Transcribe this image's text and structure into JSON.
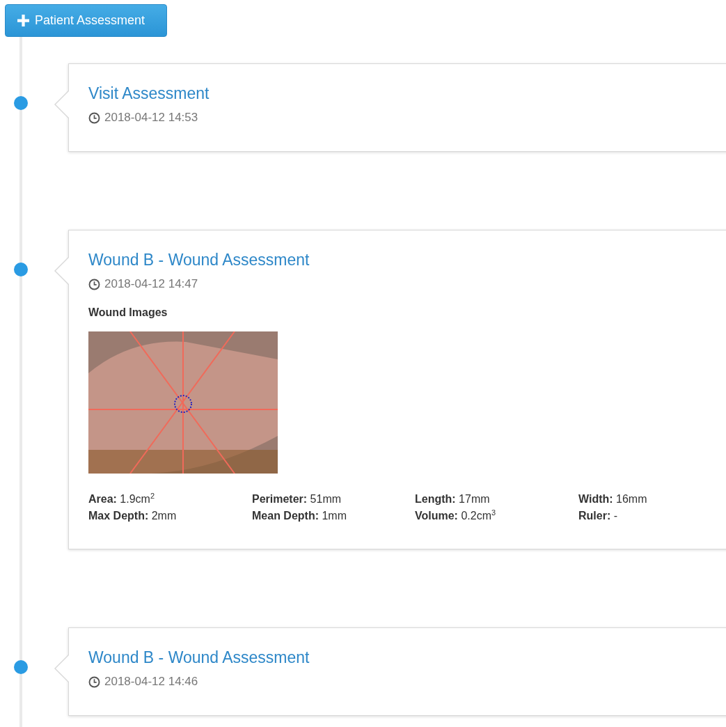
{
  "add_button": {
    "label": "Patient Assessment"
  },
  "entries": [
    {
      "title": "Visit Assessment",
      "time": "2018-04-12 14:53"
    },
    {
      "title": "Wound B - Wound Assessment",
      "time": "2018-04-12 14:47",
      "images": {
        "heading": "Wound Images"
      },
      "metrics": [
        "**Area:** 1.9cm$^{2}$",
        "**Perimeter:** 51mm",
        "**Length:** 17mm",
        "**Width:** 16mm",
        "**Max Depth:** 2mm",
        "**Mean Depth:** 1mm",
        "**Volume:** 0.2cm$^{3}$",
        "**Ruler:** -"
      ]
    },
    {
      "title": "Wound B - Wound Assessment",
      "time": "2018-04-12 14:46"
    }
  ]
}
